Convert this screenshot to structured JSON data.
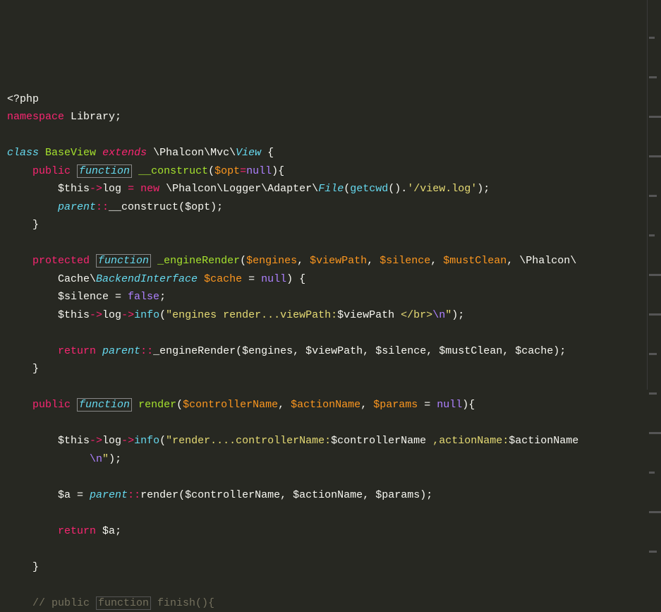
{
  "code": {
    "l1": {
      "phpTag": "<?php"
    },
    "l2": {
      "ns": "namespace",
      "lib": "Library",
      "semi": ";"
    },
    "l3": {
      "class": "class",
      "name": "BaseView",
      "extends": "extends",
      "path": "\\Phalcon\\Mvc\\",
      "view": "View",
      "brace": " {"
    },
    "l4": {
      "indent": "    ",
      "pub": "public",
      "fn": "function",
      "name": "__construct",
      "paren1": "(",
      "opt": "$opt",
      "eq": "=",
      "null": "null",
      "paren2": "){"
    },
    "l5": {
      "indent": "        ",
      "this": "$this",
      "arrow": "->",
      "log": "log",
      "sp": " ",
      "eq": "=",
      "new": "new",
      "path": "\\Phalcon\\Logger\\Adapter\\",
      "file": "File",
      "paren1": "(",
      "getcwd": "getcwd",
      "paren2": "().",
      "str": "'/view.log'",
      "end": ");"
    },
    "l6": {
      "indent": "        ",
      "parent": "parent",
      "colons": "::",
      "method": "__construct",
      "paren1": "(",
      "opt": "$opt",
      "end": ");"
    },
    "l7": {
      "indent": "    ",
      "brace": "}"
    },
    "l8": "",
    "l9": {
      "indent": "    ",
      "prot": "protected",
      "fn": "function",
      "name": "_engineRender",
      "paren1": "(",
      "p1": "$engines",
      "c1": ", ",
      "p2": "$viewPath",
      "c2": ", ",
      "p3": "$silence",
      "c3": ", ",
      "p4": "$mustClean",
      "c4": ", \\Phalcon\\"
    },
    "l10": {
      "indent": "        Cache\\",
      "iface": "BackendInterface",
      "sp": " ",
      "cache": "$cache",
      "eq": " = ",
      "null": "null",
      "end": ") {"
    },
    "l11": {
      "indent": "        ",
      "var": "$silence",
      "eq": " = ",
      "false": "false",
      "semi": ";"
    },
    "l12": {
      "indent": "        ",
      "this": "$this",
      "arrow1": "->",
      "log": "log",
      "arrow2": "->",
      "info": "info",
      "paren1": "(",
      "str1": "\"engines render...viewPath:",
      "var": "$viewPath",
      "str2": " </br>",
      "esc": "\\n",
      "str3": "\"",
      "end": ");"
    },
    "l13": "",
    "l14": {
      "indent": "        ",
      "return": "return",
      "parent": "parent",
      "colons": "::",
      "method": "_engineRender",
      "paren1": "(",
      "p1": "$engines",
      "c1": ", ",
      "p2": "$viewPath",
      "c2": ", ",
      "p3": "$silence",
      "c3": ", ",
      "p4": "$mustClean",
      "c4": ", ",
      "p5": "$cache",
      "end": ");"
    },
    "l15": {
      "indent": "    ",
      "brace": "}"
    },
    "l16": "",
    "l17": {
      "indent": "    ",
      "pub": "public",
      "fn": "function",
      "name": "render",
      "paren1": "(",
      "p1": "$controllerName",
      "c1": ", ",
      "p2": "$actionName",
      "c2": ", ",
      "p3": "$params",
      "eq": " = ",
      "null": "null",
      "end": "){"
    },
    "l18": "",
    "l19": {
      "indent": "        ",
      "this": "$this",
      "arrow1": "->",
      "log": "log",
      "arrow2": "->",
      "info": "info",
      "paren1": "(",
      "str1": "\"render....controllerName:",
      "var1": "$controllerName",
      "str2": " ,actionName:",
      "var2": "$actionName"
    },
    "l20": {
      "indent": "             ",
      "esc": "\\n",
      "str": "\"",
      "end": ");"
    },
    "l21": "",
    "l22": {
      "indent": "        ",
      "var": "$a",
      "eq": " = ",
      "parent": "parent",
      "colons": "::",
      "method": "render",
      "paren1": "(",
      "p1": "$controllerName",
      "c1": ", ",
      "p2": "$actionName",
      "c2": ", ",
      "p3": "$params",
      "end": ");"
    },
    "l23": "",
    "l24": {
      "indent": "        ",
      "return": "return",
      "var": "$a",
      "semi": ";"
    },
    "l25": "",
    "l26": {
      "indent": "    ",
      "brace": "}"
    },
    "l27": "",
    "l28": {
      "indent": "    ",
      "c1": "// public ",
      "fn": "function",
      "c2": " finish(){"
    }
  }
}
